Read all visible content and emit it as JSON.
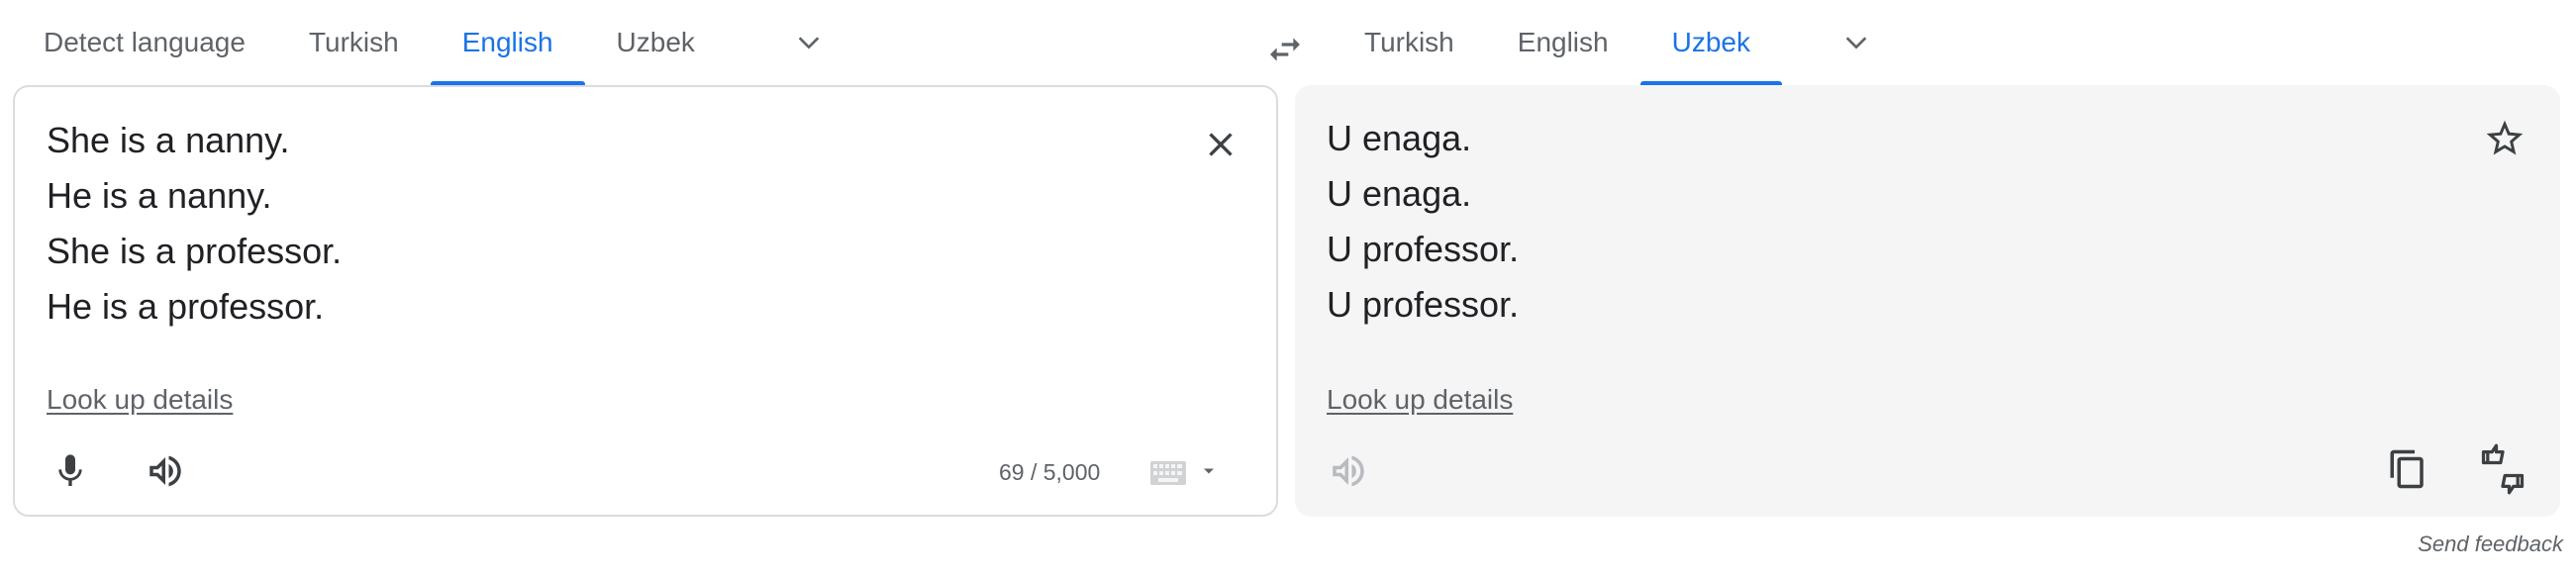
{
  "source_tabs": [
    "Detect language",
    "Turkish",
    "English",
    "Uzbek"
  ],
  "source_active": "English",
  "target_tabs": [
    "Turkish",
    "English",
    "Uzbek"
  ],
  "target_active": "Uzbek",
  "source": {
    "lines": [
      "She is a nanny.",
      "He is a nanny.",
      "She is a professor.",
      "He is a professor."
    ],
    "lookup_label": "Look up details",
    "char_count": "69 / 5,000"
  },
  "target": {
    "lines": [
      "U enaga.",
      "U enaga.",
      "U professor.",
      "U professor."
    ],
    "lookup_label": "Look up details"
  },
  "footer": {
    "feedback_label": "Send feedback"
  },
  "icons": {
    "more_source": "chevron-down-icon",
    "swap": "swap-arrows-icon",
    "more_target": "chevron-down-icon",
    "clear": "close-icon",
    "mic": "microphone-icon",
    "listen_source": "speaker-icon",
    "keyboard": "keyboard-icon",
    "input_tools_dropdown": "caret-down-icon",
    "save": "star-icon",
    "listen_target": "speaker-icon",
    "copy": "copy-icon",
    "rate": "thumbs-up-down-icon",
    "share": "share-icon"
  },
  "colors": {
    "accent": "#1a73e8",
    "text": "#202124",
    "muted": "#5f6368",
    "target_bg": "#f5f5f5",
    "border": "#dadce0"
  }
}
